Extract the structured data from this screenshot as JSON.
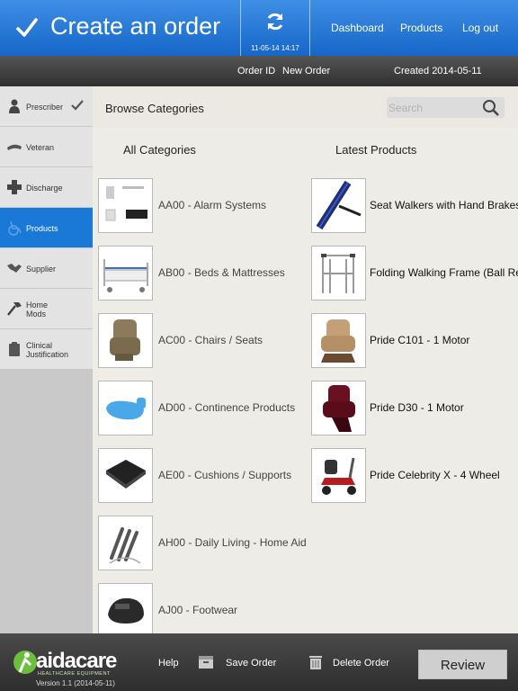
{
  "header": {
    "title": "Create an order",
    "sync_time": "11-05-14 14:17",
    "nav": [
      "Dashboard",
      "Products",
      "Log out"
    ]
  },
  "order": {
    "id_label": "Order ID",
    "id_value": "New Order",
    "created": "Created 2014-05-11"
  },
  "sidebar": {
    "items": [
      {
        "label": "Prescriber",
        "icon": "person-icon",
        "done": true
      },
      {
        "label": "Veteran",
        "icon": "veteran-icon",
        "done": false
      },
      {
        "label": "Discharge",
        "icon": "plus-cross-icon",
        "done": false
      },
      {
        "label": "Products",
        "icon": "wheelchair-icon",
        "done": false,
        "active": true
      },
      {
        "label": "Supplier",
        "icon": "handshake-icon",
        "done": false
      },
      {
        "label": "Home\nMods",
        "icon": "hammer-icon",
        "done": false
      },
      {
        "label": "Clinical\nJustification",
        "icon": "clipboard-icon",
        "done": false
      }
    ],
    "active_color": "#1a79d6"
  },
  "main": {
    "browse_title": "Browse Categories",
    "search_placeholder": "Search",
    "categories_heading": "All Categories",
    "latest_heading": "Latest Products",
    "categories": [
      "AA00 - Alarm Systems",
      "AB00 - Beds & Mattresses",
      "AC00 - Chairs / Seats",
      "AD00 - Continence Products",
      "AE00 - Cushions / Supports",
      "AH00 - Daily Living - Home Aid",
      "AJ00 - Footwear"
    ],
    "latest_products": [
      "Seat Walkers with Hand Brakes",
      "Folding Walking Frame (Ball Re",
      "Pride C101 - 1 Motor",
      "Pride D30 - 1 Motor",
      "Pride Celebrity X - 4 Wheel"
    ]
  },
  "footer": {
    "logo_text": "aidacare",
    "logo_sub": "HEALTHCARE EQUIPMENT",
    "version": "Version 1.1 (2014-05-11)",
    "help": "Help",
    "save": "Save Order",
    "delete": "Delete Order",
    "review": "Review"
  },
  "colors": {
    "header_top": "#3f8fe6",
    "header_bottom": "#1566c8",
    "accent_green": "#6cbf3c"
  }
}
